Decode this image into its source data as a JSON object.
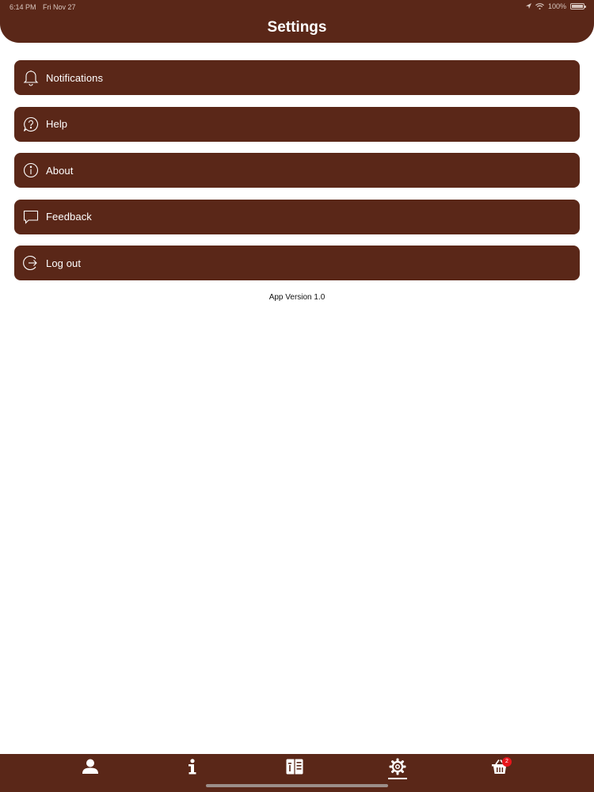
{
  "status_bar": {
    "time": "6:14 PM",
    "date": "Fri Nov 27",
    "battery_text": "100%",
    "battery_level": 1.0
  },
  "header": {
    "title": "Settings"
  },
  "menu": {
    "items": [
      {
        "label": "Notifications",
        "icon": "bell-icon"
      },
      {
        "label": "Help",
        "icon": "help-icon"
      },
      {
        "label": "About",
        "icon": "info-icon"
      },
      {
        "label": "Feedback",
        "icon": "feedback-icon"
      },
      {
        "label": "Log out",
        "icon": "logout-icon"
      }
    ]
  },
  "footer": {
    "app_version": "App Version 1.0"
  },
  "tabbar": {
    "tabs": [
      {
        "icon": "profile-icon"
      },
      {
        "icon": "info-icon"
      },
      {
        "icon": "menu-book-icon"
      },
      {
        "icon": "settings-gear-icon",
        "active": true
      },
      {
        "icon": "basket-icon",
        "badge": "2"
      }
    ]
  },
  "colors": {
    "brand": "#5a2718",
    "badge": "#e8151b",
    "text_light": "#ffffff"
  }
}
